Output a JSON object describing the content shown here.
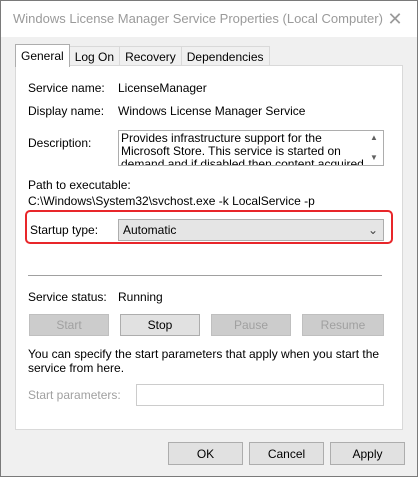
{
  "window": {
    "title": "Windows License Manager Service Properties (Local Computer)",
    "close_glyph": "✕"
  },
  "tabs": [
    {
      "label": "General",
      "active": true
    },
    {
      "label": "Log On",
      "active": false
    },
    {
      "label": "Recovery",
      "active": false
    },
    {
      "label": "Dependencies",
      "active": false
    }
  ],
  "general": {
    "service_name_label": "Service name:",
    "service_name": "LicenseManager",
    "display_name_label": "Display name:",
    "display_name": "Windows License Manager Service",
    "description_label": "Description:",
    "description": "Provides infrastructure support for the Microsoft Store.  This service is started on demand and if disabled then content acquired through the",
    "path_label": "Path to executable:",
    "path": "C:\\Windows\\System32\\svchost.exe -k LocalService -p",
    "startup_type_label": "Startup type:",
    "startup_type": "Automatic",
    "service_status_label": "Service status:",
    "service_status": "Running",
    "buttons": {
      "start": "Start",
      "stop": "Stop",
      "pause": "Pause",
      "resume": "Resume"
    },
    "note": "You can specify the start parameters that apply when you start the service from here.",
    "start_params_label": "Start parameters:",
    "start_params_value": ""
  },
  "footer": {
    "ok": "OK",
    "cancel": "Cancel",
    "apply": "Apply"
  },
  "colors": {
    "highlight": "#e8262a"
  }
}
